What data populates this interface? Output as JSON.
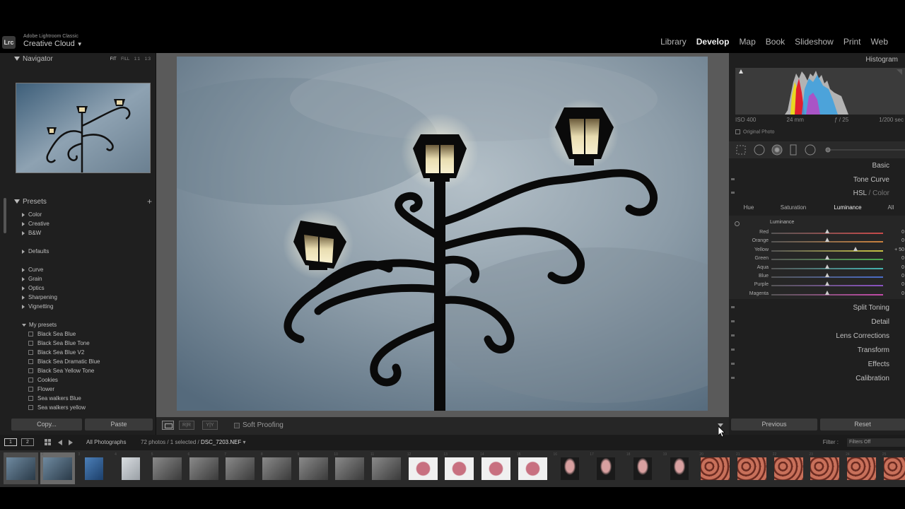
{
  "app": {
    "brand_small": "Adobe Lightroom Classic",
    "brand_big": "Creative Cloud",
    "logo": "Lrc",
    "modules": [
      "Library",
      "Develop",
      "Map",
      "Book",
      "Slideshow",
      "Print",
      "Web"
    ],
    "active_module": "Develop"
  },
  "navigator": {
    "title": "Navigator",
    "zoom": [
      "FIT",
      "FILL",
      "1:1",
      "1:3"
    ]
  },
  "presets": {
    "title": "Presets",
    "add": "+",
    "groups_a": [
      "Color",
      "Creative",
      "B&W"
    ],
    "groups_b": [
      "Defaults"
    ],
    "groups_c": [
      "Curve",
      "Grain",
      "Optics",
      "Sharpening",
      "Vignetting"
    ],
    "my_presets_label": "My presets",
    "my_presets": [
      "Black Sea Blue",
      "Black Sea Blue Tone",
      "Black Sea Blue V2",
      "Black Sea Dramatic Blue",
      "Black Sea Yellow Tone",
      "Cookies",
      "Flower",
      "Sea walkers Blue",
      "Sea walkers yellow"
    ]
  },
  "left_buttons": {
    "copy": "Copy...",
    "paste": "Paste"
  },
  "toolbar": {
    "soft_proofing": "Soft Proofing"
  },
  "histogram": {
    "title": "Histogram",
    "iso": "ISO 400",
    "focal": "24 mm",
    "aperture": "ƒ / 25",
    "shutter": "1/200 sec",
    "original_photo": "Original Photo"
  },
  "sections": {
    "basic": "Basic",
    "tone_curve": "Tone Curve",
    "hsl": "HSL",
    "hsl_sep": " / ",
    "color": "Color",
    "split_toning": "Split Toning",
    "detail": "Detail",
    "lens": "Lens Corrections",
    "transform": "Transform",
    "effects": "Effects",
    "calibration": "Calibration"
  },
  "hsl": {
    "tabs": [
      "Hue",
      "Saturation",
      "Luminance",
      "All"
    ],
    "active_tab": "Luminance",
    "group_title": "Luminance",
    "sliders": [
      {
        "label": "Red",
        "value": "0",
        "pos": 0.5,
        "color": "#c84a4a"
      },
      {
        "label": "Orange",
        "value": "0",
        "pos": 0.5,
        "color": "#c9813e"
      },
      {
        "label": "Yellow",
        "value": "+ 50",
        "pos": 0.75,
        "color": "#c8c244"
      },
      {
        "label": "Green",
        "value": "0",
        "pos": 0.5,
        "color": "#4cae52"
      },
      {
        "label": "Aqua",
        "value": "0",
        "pos": 0.5,
        "color": "#44b3b0"
      },
      {
        "label": "Blue",
        "value": "0",
        "pos": 0.5,
        "color": "#4a6cc8"
      },
      {
        "label": "Purple",
        "value": "0",
        "pos": 0.5,
        "color": "#8a52c2"
      },
      {
        "label": "Magenta",
        "value": "0",
        "pos": 0.5,
        "color": "#c24aa8"
      }
    ]
  },
  "right_buttons": {
    "previous": "Previous",
    "reset": "Reset"
  },
  "filmstrip_bar": {
    "monitor1": "1",
    "monitor2": "2",
    "source": "All Photographs",
    "count": "72 photos / 1 selected / ",
    "filename": "DSC_7203.NEF",
    "filename_suffix": " ▾",
    "filter_label": "Filter :",
    "filter_value": "Filters Off"
  },
  "filmstrip": {
    "numbers": [
      "1",
      "2",
      "3",
      "4",
      "5",
      "6",
      "7",
      "8",
      "9",
      "10",
      "11",
      "12",
      "13",
      "14",
      "15",
      "16",
      "17",
      "18",
      "19",
      "20",
      "21",
      "22",
      "23",
      "24",
      "25"
    ],
    "kinds": [
      "lamp",
      "lamp",
      "lampblue",
      "lamppale",
      "bw",
      "bw",
      "bw",
      "bw",
      "bw",
      "bw",
      "bw",
      "rose",
      "rose",
      "rose",
      "rose",
      "flower",
      "flower",
      "flower",
      "flower",
      "cookie",
      "cookie",
      "cookie",
      "cookie",
      "cookie",
      "cookie"
    ],
    "selected_index": 1
  },
  "colors": {
    "accent": "#f0f0f0",
    "panel": "#1f1f1f",
    "canvas": "#5a5a5a"
  }
}
